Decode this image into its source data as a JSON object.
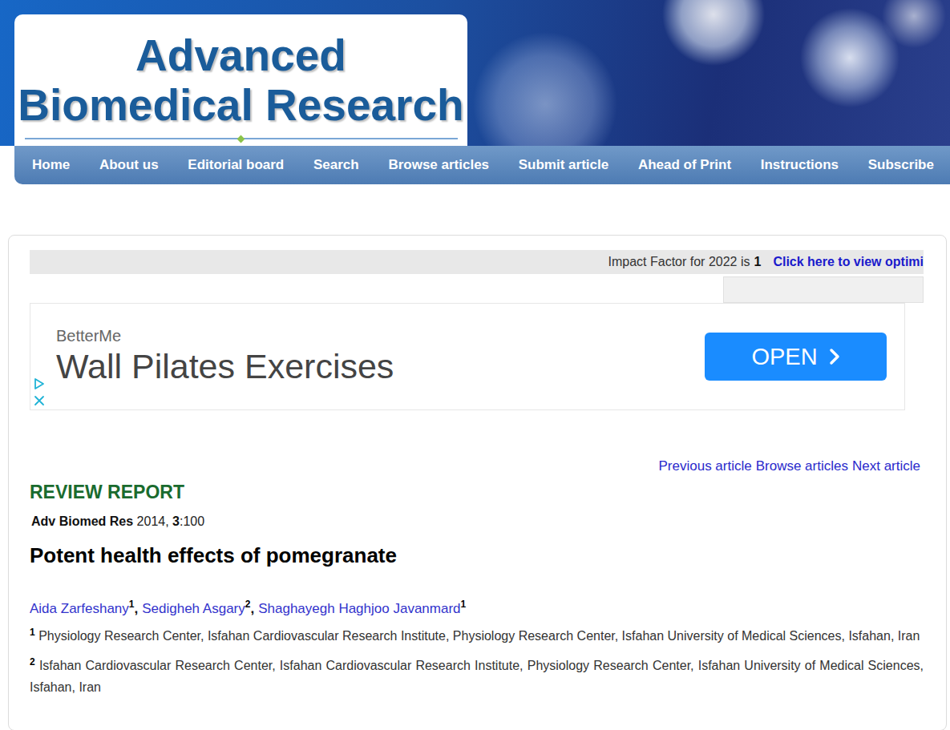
{
  "logo": {
    "line1": "Advanced",
    "line2": "Biomedical Research"
  },
  "nav": [
    {
      "label": "Home"
    },
    {
      "label": "About us"
    },
    {
      "label": "Editorial board"
    },
    {
      "label": "Search"
    },
    {
      "label": "Browse articles"
    },
    {
      "label": "Submit article"
    },
    {
      "label": "Ahead of Print"
    },
    {
      "label": "Instructions"
    },
    {
      "label": "Subscribe"
    }
  ],
  "impact_bar": {
    "label": "Impact Factor for 2022 is",
    "value": "1",
    "link": "Click here to view optimi"
  },
  "ad": {
    "brand": "BetterMe",
    "headline": "Wall Pilates Exercises",
    "button": "OPEN"
  },
  "article_nav": [
    "Previous article",
    "Browse articles",
    "Next article"
  ],
  "section": "REVIEW REPORT",
  "citation": {
    "journal": "Adv Biomed Res",
    "year": "2014,",
    "volume": "3",
    "pages": ":100"
  },
  "title": "Potent health effects of pomegranate",
  "authors": [
    {
      "name": "Aida Zarfeshany",
      "affiliation": "1",
      "separator": ","
    },
    {
      "name": "Sedigheh Asgary",
      "affiliation": "2",
      "separator": ","
    },
    {
      "name": "Shaghayegh Haghjoo Javanmard",
      "affiliation": "1",
      "separator": ""
    }
  ],
  "affiliations": [
    {
      "number": "1",
      "text": "Physiology Research Center, Isfahan Cardiovascular Research Institute, Physiology Research Center, Isfahan University of Medical Sciences, Isfahan, Iran"
    },
    {
      "number": "2",
      "text": "Isfahan Cardiovascular Research Center, Isfahan Cardiovascular Research Institute, Physiology Research Center, Isfahan University of Medical Sciences, Isfahan, Iran"
    }
  ]
}
